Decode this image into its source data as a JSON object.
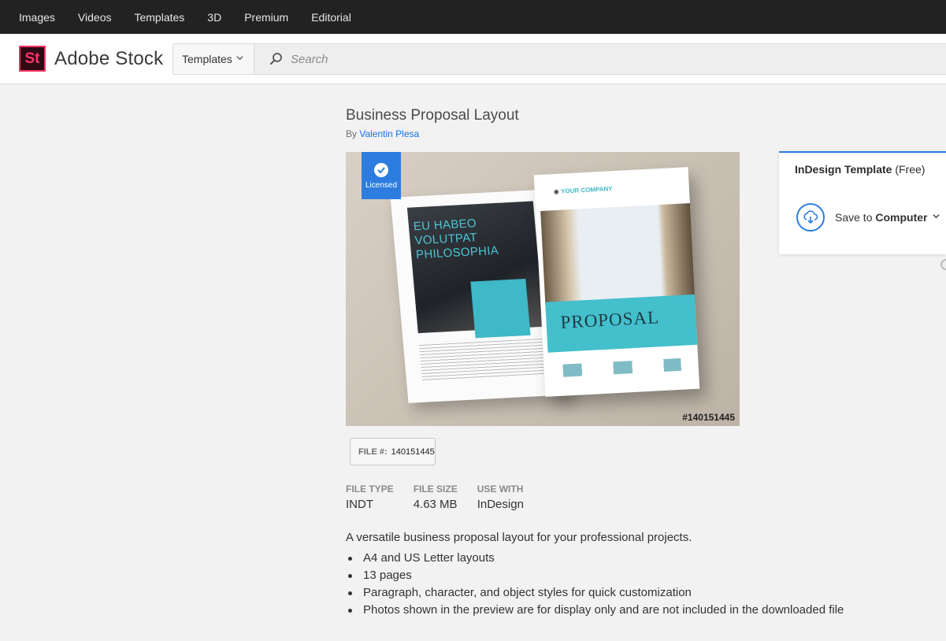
{
  "topnav": {
    "items": [
      "Images",
      "Videos",
      "Templates",
      "3D",
      "Premium",
      "Editorial"
    ]
  },
  "header": {
    "logo_mark": "St",
    "logo_text": "Adobe Stock",
    "category": "Templates",
    "search_placeholder": "Search"
  },
  "asset": {
    "title": "Business Proposal Layout",
    "by_label": "By",
    "author": "Valentin Plesa",
    "licensed_label": "Licensed",
    "image_file_tag": "#140151445",
    "preview_headline": "EU HABEO VOLUTPAT PHILOSOPHIA",
    "preview_company": "YOUR COMPANY",
    "preview_proposal": "PROPOSAL",
    "file_no_label": "FILE #:",
    "file_no": "140151445",
    "specs": [
      {
        "key": "FILE TYPE",
        "value": "INDT"
      },
      {
        "key": "FILE SIZE",
        "value": "4.63 MB"
      },
      {
        "key": "USE WITH",
        "value": "InDesign"
      }
    ],
    "description": "A versatile business proposal layout for your professional projects.",
    "bullets": [
      "A4 and US Letter layouts",
      "13 pages",
      "Paragraph, character, and object styles for quick customization",
      "Photos shown in the preview are for display only and are not included in the downloaded file"
    ]
  },
  "download": {
    "type_label": "InDesign Template",
    "price_label": "(Free)",
    "save_to": "Save to",
    "destination": "Computer"
  },
  "colors": {
    "accent": "#2d7de0",
    "link": "#1473e6",
    "brand": "#ff3366",
    "topnav_bg": "#222222"
  }
}
